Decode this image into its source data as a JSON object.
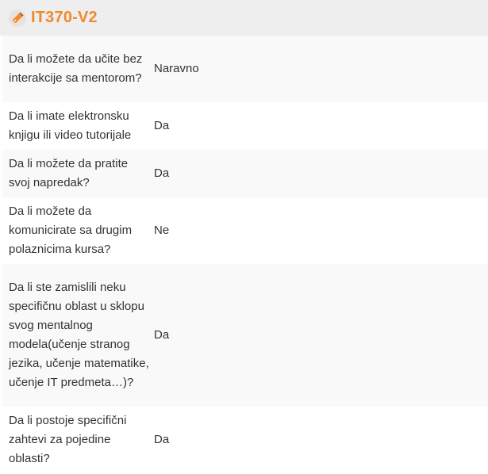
{
  "header": {
    "title": "IT370-V2",
    "logo_icon": "pen-nib-icon",
    "title_color": "#f08a2e"
  },
  "rows": [
    {
      "question": "Da li možete da učite bez interakcije sa mentorom?",
      "answer": "Naravno"
    },
    {
      "question": "Da li imate elektronsku knjigu ili video tutorijale",
      "answer": "Da"
    },
    {
      "question": "Da li možete da pratite svoj napredak?",
      "answer": "Da"
    },
    {
      "question": "Da li možete da komunicirate sa drugim polaznicima kursa?",
      "answer": "Ne"
    },
    {
      "question": "Da li ste zamislili neku specifičnu oblast u sklopu svog mentalnog modela(učenje stranog jezika, učenje matematike, učenje IT predmeta…)?",
      "answer": "Da"
    },
    {
      "question": "Da li postoje specifični zahtevi za pojedine oblasti?",
      "answer": "Da"
    }
  ]
}
